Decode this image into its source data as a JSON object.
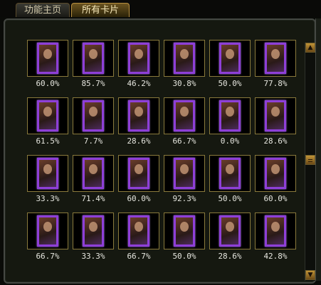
{
  "tabs": [
    {
      "label": "功能主页",
      "active": false
    },
    {
      "label": "所有卡片",
      "active": true
    }
  ],
  "cards": [
    {
      "percent": "60.0%"
    },
    {
      "percent": "85.7%"
    },
    {
      "percent": "46.2%"
    },
    {
      "percent": "30.8%"
    },
    {
      "percent": "50.0%"
    },
    {
      "percent": "77.8%"
    },
    {
      "percent": "61.5%"
    },
    {
      "percent": "7.7%"
    },
    {
      "percent": "28.6%"
    },
    {
      "percent": "66.7%"
    },
    {
      "percent": "0.0%"
    },
    {
      "percent": "28.6%"
    },
    {
      "percent": "33.3%"
    },
    {
      "percent": "71.4%"
    },
    {
      "percent": "60.0%"
    },
    {
      "percent": "92.3%"
    },
    {
      "percent": "50.0%"
    },
    {
      "percent": "60.0%"
    },
    {
      "percent": "66.7%"
    },
    {
      "percent": "33.3%"
    },
    {
      "percent": "66.7%"
    },
    {
      "percent": "50.0%"
    },
    {
      "percent": "28.6%"
    },
    {
      "percent": "42.8%"
    }
  ],
  "scrollbar": {
    "up_icon": "triangle-up-icon",
    "down_icon": "triangle-down-icon",
    "thumb_icon": "scroll-thumb-icon"
  },
  "colors": {
    "card_border": "#8e3fd8",
    "frame_border": "#8a7a3c",
    "accent_gold": "#c09437"
  }
}
